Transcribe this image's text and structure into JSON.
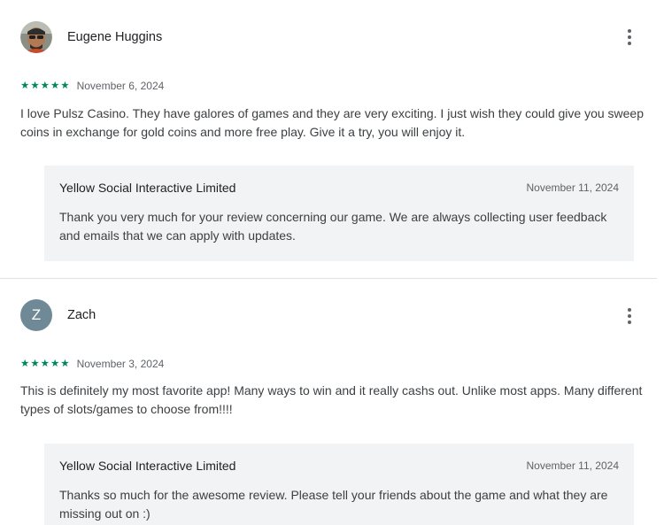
{
  "reviews": [
    {
      "author": "Eugene Huggins",
      "avatar_type": "photo",
      "rating": 5,
      "stars": [
        "★",
        "★",
        "★",
        "★",
        "★"
      ],
      "date": "November 6, 2024",
      "text": "I love Pulsz Casino. They have galores of games and they are very exciting. I just wish they could give you sweep coins in exchange for gold coins and more free play. Give it a try, you will enjoy it.",
      "reply": {
        "author": "Yellow Social Interactive Limited",
        "date": "November 11, 2024",
        "text": "Thank you very much for your review concerning our game. We are always collecting user feedback and emails that we can apply with updates."
      }
    },
    {
      "author": "Zach",
      "avatar_letter": "Z",
      "avatar_color": "#6f8a96",
      "rating": 5,
      "stars": [
        "★",
        "★",
        "★",
        "★",
        "★"
      ],
      "date": "November 3, 2024",
      "text": "This is definitely my most favorite app! Many ways to win and it really cashs out. Unlike most apps. Many different types of slots/games to choose from!!!!",
      "reply": {
        "author": "Yellow Social Interactive Limited",
        "date": "November 11, 2024",
        "text": "Thanks so much for the awesome review. Please tell your friends about the game and what they are missing out on :)"
      }
    }
  ],
  "colors": {
    "star": "#01875f",
    "reply_background": "#f1f3f4",
    "avatar_z": "#6f8a96"
  },
  "icons": {
    "more_options": "more-vert-icon"
  }
}
